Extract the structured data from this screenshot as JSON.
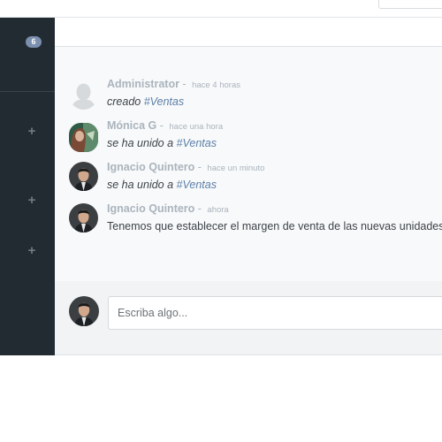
{
  "sidebar": {
    "badge": "6",
    "add_icons": [
      "+",
      "+",
      "+"
    ]
  },
  "messages": [
    {
      "author": "Administrator",
      "time": "hace 4 horas",
      "text_prefix": "creado ",
      "tag": "#Ventas",
      "avatar": "default-avatar"
    },
    {
      "author": "Mónica G",
      "time": "hace una hora",
      "text_prefix": "se ha unido a ",
      "tag": "#Ventas",
      "avatar": "user-photo"
    },
    {
      "author": "Ignacio Quintero",
      "time": "hace un minuto",
      "text_prefix": "se ha unido a ",
      "tag": "#Ventas",
      "avatar": "user-photo"
    },
    {
      "author": "Ignacio Quintero",
      "time": "ahora",
      "text": "Tenemos que establecer el margen de venta de las nuevas unidades",
      "avatar": "user-photo"
    }
  ],
  "composer": {
    "placeholder": "Escriba algo..."
  },
  "colors": {
    "sidebar_bg": "#222b31",
    "badge_bg": "#7b8fae",
    "tag_link": "#5b7fa8",
    "author_text": "#aab4bd"
  }
}
